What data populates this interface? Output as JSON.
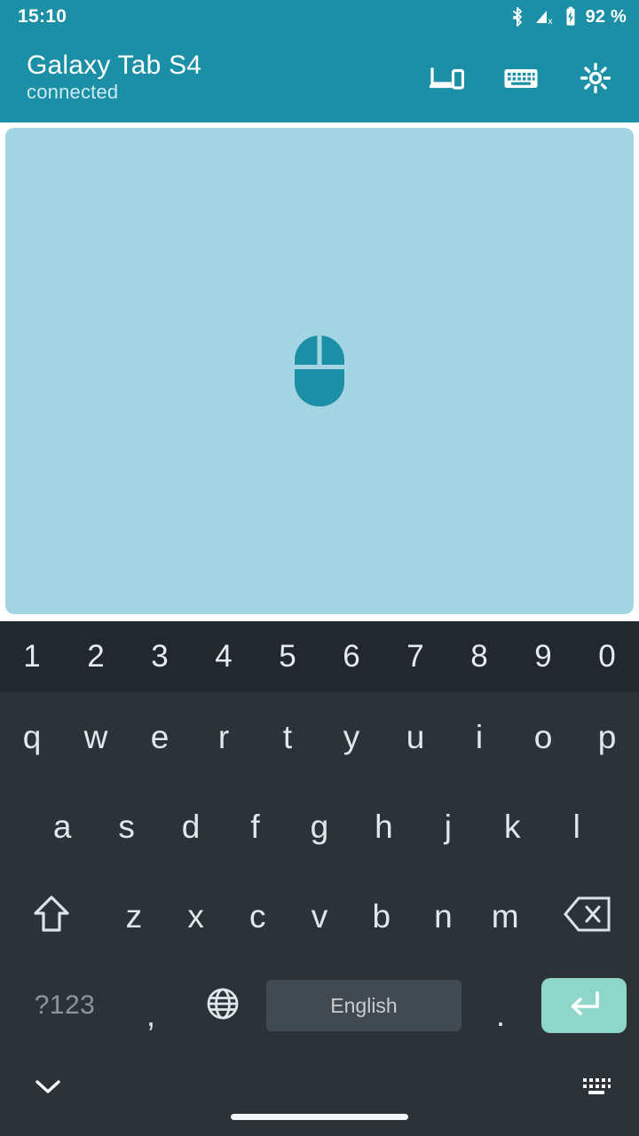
{
  "status_bar": {
    "time": "15:10",
    "battery_percent": "92 %",
    "icons": [
      "bluetooth-icon",
      "cellular-signal-off-icon",
      "battery-charging-icon"
    ]
  },
  "app_bar": {
    "title": "Galaxy Tab S4",
    "subtitle": "connected",
    "accent_color": "#1a8fa6",
    "actions": [
      {
        "name": "devices-icon",
        "label": "Devices"
      },
      {
        "name": "keyboard-icon",
        "label": "Keyboard"
      },
      {
        "name": "settings-gear-icon",
        "label": "Settings"
      }
    ]
  },
  "touchpad": {
    "name": "touchpad-surface",
    "background_color": "#a3d5e3",
    "icon": "mouse-icon",
    "icon_color": "#1a8fa6"
  },
  "keyboard": {
    "number_row": [
      "1",
      "2",
      "3",
      "4",
      "5",
      "6",
      "7",
      "8",
      "9",
      "0"
    ],
    "row1": [
      "q",
      "w",
      "e",
      "r",
      "t",
      "y",
      "u",
      "i",
      "o",
      "p"
    ],
    "row2": [
      "a",
      "s",
      "d",
      "f",
      "g",
      "h",
      "j",
      "k",
      "l"
    ],
    "row3": [
      "z",
      "x",
      "c",
      "v",
      "b",
      "n",
      "m"
    ],
    "shift_key": "shift-key",
    "backspace_key": "backspace-key",
    "bottom_row": {
      "symbols_label": "?123",
      "comma": ",",
      "globe": "globe-icon",
      "space_label": "English",
      "period": ".",
      "enter": "enter-key"
    },
    "key_text_color": "#e2e7ea",
    "number_row_bg": "#22282d",
    "keyboard_bg": "#2b3238",
    "spacebar_bg": "#414a50",
    "enter_bg": "#8ed6ca"
  },
  "nav_bar": {
    "hide_keyboard": "chevron-down-icon",
    "home_indicator": "home-indicator-pill",
    "keyboard_switcher": "keyboard-switcher-icon"
  }
}
